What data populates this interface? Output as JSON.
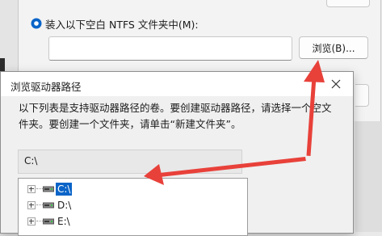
{
  "parent_dialog": {
    "radio_option_label": "装入以下空白 NTFS 文件夹中(M):",
    "folder_path_value": "",
    "browse_button_label": "浏览(B)..."
  },
  "browse_dialog": {
    "title": "浏览驱动器路径",
    "description": "以下列表是支持驱动器路径的卷。要创建驱动器路径，请选择一个空文件夹。要创建一个文件夹，请单击“新建文件夹”。",
    "selected_path": "C:\\",
    "tree": [
      {
        "label": "C:\\",
        "selected": true
      },
      {
        "label": "D:\\",
        "selected": false
      },
      {
        "label": "E:\\",
        "selected": false
      }
    ]
  },
  "colors": {
    "accent": "#0a64c8",
    "annotation_arrow": "#e8413a"
  },
  "icons": [
    "close-icon",
    "drive-icon",
    "expand-icon",
    "radio-selected-icon"
  ]
}
